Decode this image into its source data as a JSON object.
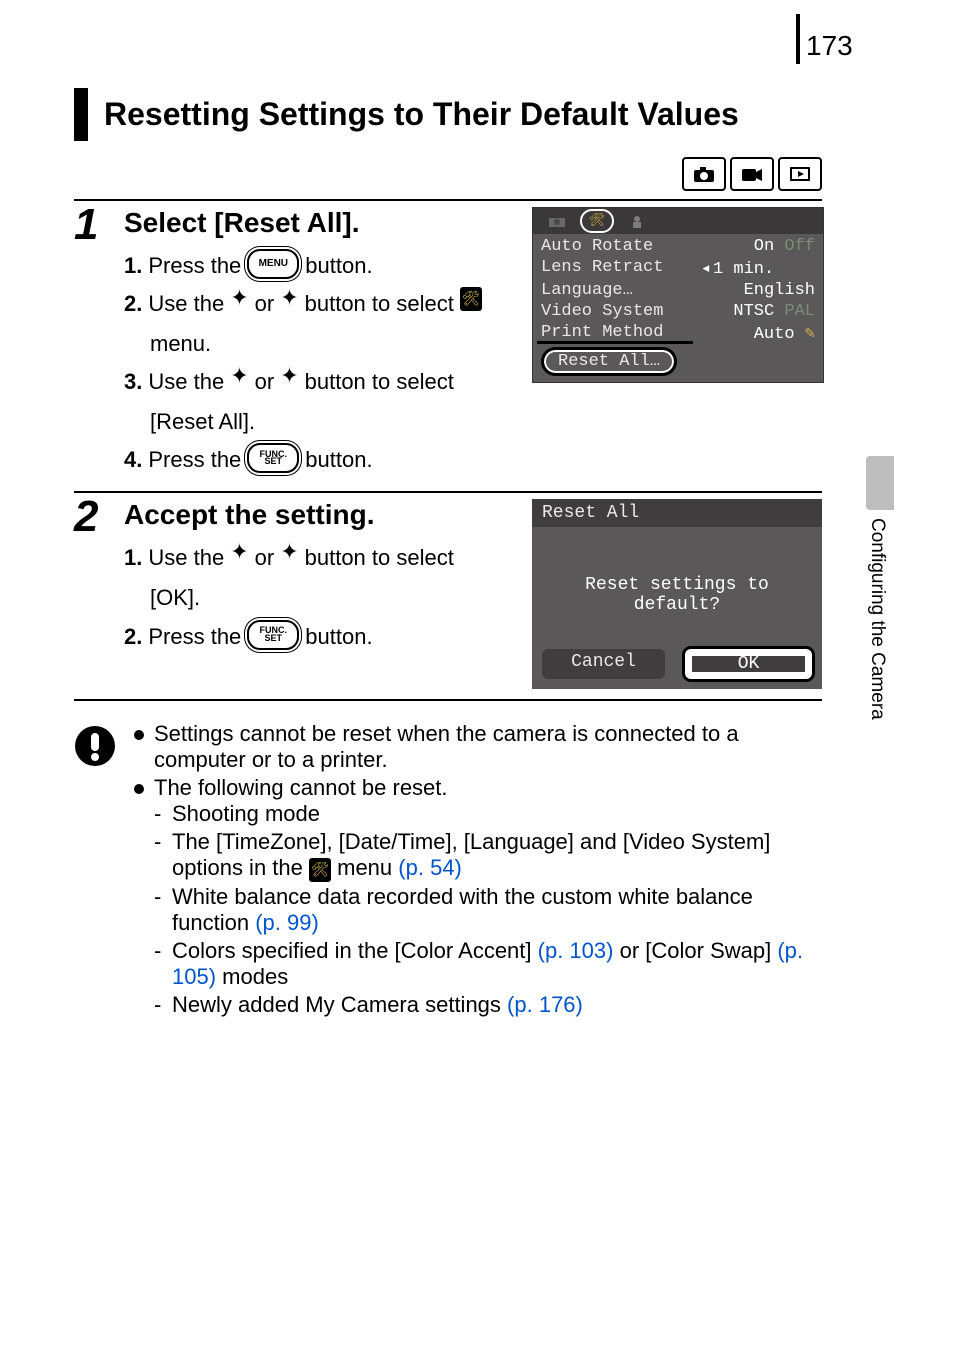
{
  "pageNumber": "173",
  "sideTab": "Configuring the Camera",
  "title": "Resetting Settings to Their Default Values",
  "steps": [
    {
      "num": "1",
      "title": "Select [Reset All].",
      "items": {
        "i1a": "1.",
        "i1b": "Press the",
        "i1c": "button.",
        "i2a": "2.",
        "i2b": "Use the",
        "i2c": "or",
        "i2d": "button to select",
        "i2e": "menu.",
        "i3a": "3.",
        "i3b": "Use the",
        "i3c": "or",
        "i3d": "button to select",
        "i3e": "[Reset All].",
        "i4a": "4.",
        "i4b": "Press the",
        "i4c": "button."
      },
      "lcd": {
        "rows": [
          {
            "label": "Auto Rotate",
            "v1": "On",
            "v2": "Off"
          },
          {
            "label": "Lens Retract",
            "pre": "◂",
            "v1": "1 min."
          },
          {
            "label": "Language…",
            "v1": "English"
          },
          {
            "label": "Video System",
            "v1": "NTSC",
            "v2": "PAL"
          },
          {
            "label": "Print Method",
            "v1": "Auto",
            "icon": true,
            "strike": true
          }
        ],
        "reset": "Reset All…"
      }
    },
    {
      "num": "2",
      "title": "Accept the setting.",
      "items": {
        "i1a": "1.",
        "i1b": "Use the",
        "i1c": "or",
        "i1d": "button to select",
        "i1e": "[OK].",
        "i2a": "2.",
        "i2b": "Press the",
        "i2c": "button."
      },
      "dlg": {
        "title": "Reset All",
        "msg": "Reset settings to default?",
        "cancel": "Cancel",
        "ok": "OK"
      }
    }
  ],
  "note": {
    "b1": "Settings cannot be reset when the camera is connected to a computer or to a printer.",
    "b2": "The following cannot be reset.",
    "s1": "Shooting mode",
    "s2a": "The [TimeZone], [Date/Time], [Language] and [Video System] options in the",
    "s2b": "menu",
    "s2link": "(p. 54)",
    "s3a": "White balance data recorded with the custom white balance function",
    "s3link": "(p. 99)",
    "s4a": "Colors specified in the [Color Accent]",
    "s4link1": "(p. 103)",
    "s4b": "or [Color Swap]",
    "s4link2": "(p. 105)",
    "s4c": "modes",
    "s5a": "Newly added My Camera settings",
    "s5link": "(p. 176)"
  },
  "buttons": {
    "menu": "MENU",
    "funcTop": "FUNC.",
    "funcBot": "SET"
  }
}
